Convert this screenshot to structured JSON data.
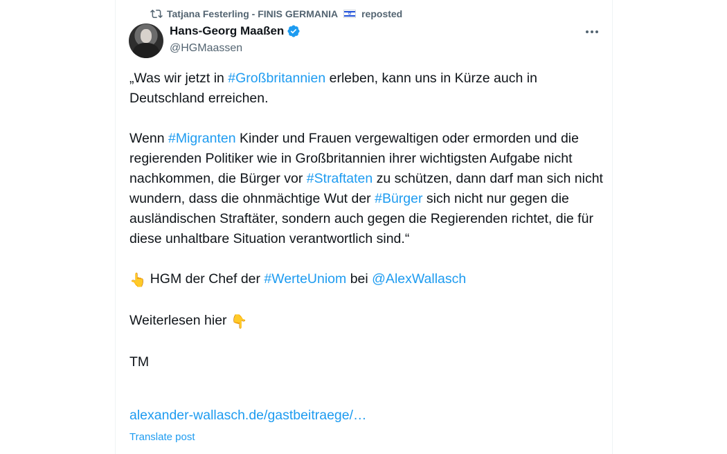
{
  "repost": {
    "icon": "repost-icon",
    "user": "Tatjana Festerling - FINIS GERMANIA",
    "flag_emoji": "🇮🇱",
    "suffix": "reposted"
  },
  "author": {
    "name": "Hans-Georg Maaßen",
    "handle": "@HGMaassen",
    "verified_icon": "verified-badge-icon",
    "avatar_icon": "avatar"
  },
  "tweet": {
    "p1": {
      "t1": "„Was wir jetzt in ",
      "h1": "#Großbritannien",
      "t2": " erleben, kann uns in Kürze auch in Deutschland erreichen."
    },
    "p2": {
      "t1": "Wenn ",
      "h1": "#Migranten",
      "t2": " Kinder und Frauen vergewaltigen oder ermorden und die regierenden Politiker wie in Großbritannien ihrer wichtigsten Aufgabe nicht nachkommen, die Bürger vor ",
      "h2": "#Straftaten",
      "t3": " zu schützen, dann darf man sich nicht wundern, dass die ohnmächtige Wut der ",
      "h3": "#Bürger",
      "t4": " sich nicht nur gegen die ausländischen Straftäter, sondern auch gegen die Regierenden richtet, die für diese unhaltbare Situation verantwortlich sind.“"
    },
    "p3": {
      "emoji": "👆",
      "t1": " HGM der Chef der ",
      "h1": "#WerteUniom",
      "t2": " bei ",
      "mention": "@AlexWallasch"
    },
    "p4": {
      "t1": "Weiterlesen hier ",
      "emoji": "👇"
    },
    "p5": "TM",
    "link": "alexander-wallasch.de/gastbeitraege/…",
    "translate": "Translate post"
  },
  "colors": {
    "accent": "#1d9bf0",
    "text": "#0f1419",
    "muted": "#536471"
  }
}
